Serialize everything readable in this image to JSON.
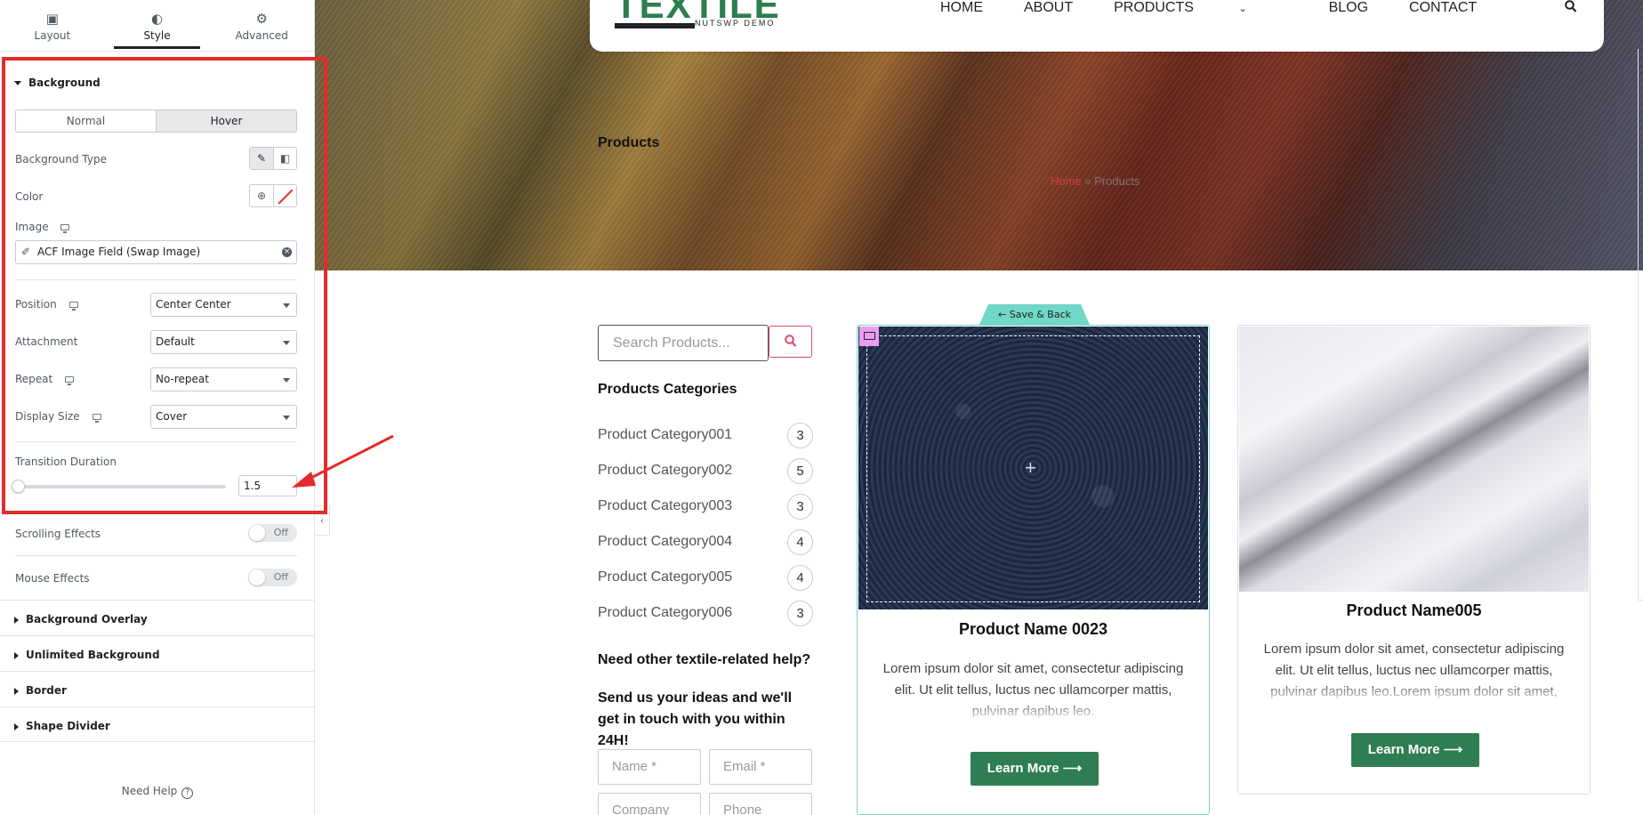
{
  "panel": {
    "tabs": [
      {
        "label": "Layout",
        "icon": "layout-icon"
      },
      {
        "label": "Style",
        "icon": "contrast-icon"
      },
      {
        "label": "Advanced",
        "icon": "gear-icon"
      }
    ],
    "background": {
      "title": "Background",
      "state_normal": "Normal",
      "state_hover": "Hover",
      "type_label": "Background Type",
      "color_label": "Color",
      "image_label": "Image",
      "image_value": "ACF Image Field (Swap Image)",
      "position_label": "Position",
      "position_value": "Center Center",
      "attachment_label": "Attachment",
      "attachment_value": "Default",
      "repeat_label": "Repeat",
      "repeat_value": "No-repeat",
      "display_size_label": "Display Size",
      "display_size_value": "Cover",
      "transition_label": "Transition Duration",
      "transition_value": "1.5"
    },
    "scrolling_label": "Scrolling Effects",
    "scrolling_state": "Off",
    "mouse_label": "Mouse Effects",
    "mouse_state": "Off",
    "sections": [
      "Background Overlay",
      "Unlimited Background",
      "Border",
      "Shape Divider"
    ],
    "need_help": "Need Help",
    "highlight_color": "#e32c2c"
  },
  "site": {
    "logo": "TEXTILE",
    "logo_sub": "NUTSWP DEMO",
    "nav": [
      "HOME",
      "ABOUT",
      "PRODUCTS",
      "BLOG",
      "CONTACT"
    ],
    "active_nav": "PRODUCTS",
    "page_title": "Products",
    "breadcrumb": {
      "home": "Home",
      "sep": "»",
      "current": "Products"
    },
    "search_placeholder": "Search Products...",
    "categories_title": "Products Categories",
    "categories": [
      {
        "name": "Product Category001",
        "count": "3"
      },
      {
        "name": "Product Category002",
        "count": "5"
      },
      {
        "name": "Product Category003",
        "count": "3"
      },
      {
        "name": "Product Category004",
        "count": "4"
      },
      {
        "name": "Product Category005",
        "count": "4"
      },
      {
        "name": "Product Category006",
        "count": "3"
      }
    ],
    "help_title": "Need other textile-related help?",
    "help_text": "Send us your ideas and we'll get in touch with you within 24H!",
    "form": {
      "name": "Name *",
      "email": "Email *",
      "company": "Company",
      "phone": "Phone"
    },
    "save_back": "Save & Back",
    "cards": [
      {
        "title": "Product Name 0023",
        "text": "Lorem ipsum dolor sit amet, consectetur adipiscing elit. Ut elit tellus, luctus nec ullamcorper mattis, pulvinar dapibus leo.",
        "button": "Learn More ⟶"
      },
      {
        "title": "Product Name005",
        "text": "Lorem ipsum dolor sit amet, consectetur adipiscing elit. Ut elit tellus, luctus nec ullamcorper mattis, pulvinar dapibus leo.Lorem ipsum dolor sit amet, consectetur adipiscing elit.",
        "button": "Learn More ⟶"
      }
    ],
    "brand_color": "#2e7d4f",
    "accent_color": "#d6506a"
  }
}
